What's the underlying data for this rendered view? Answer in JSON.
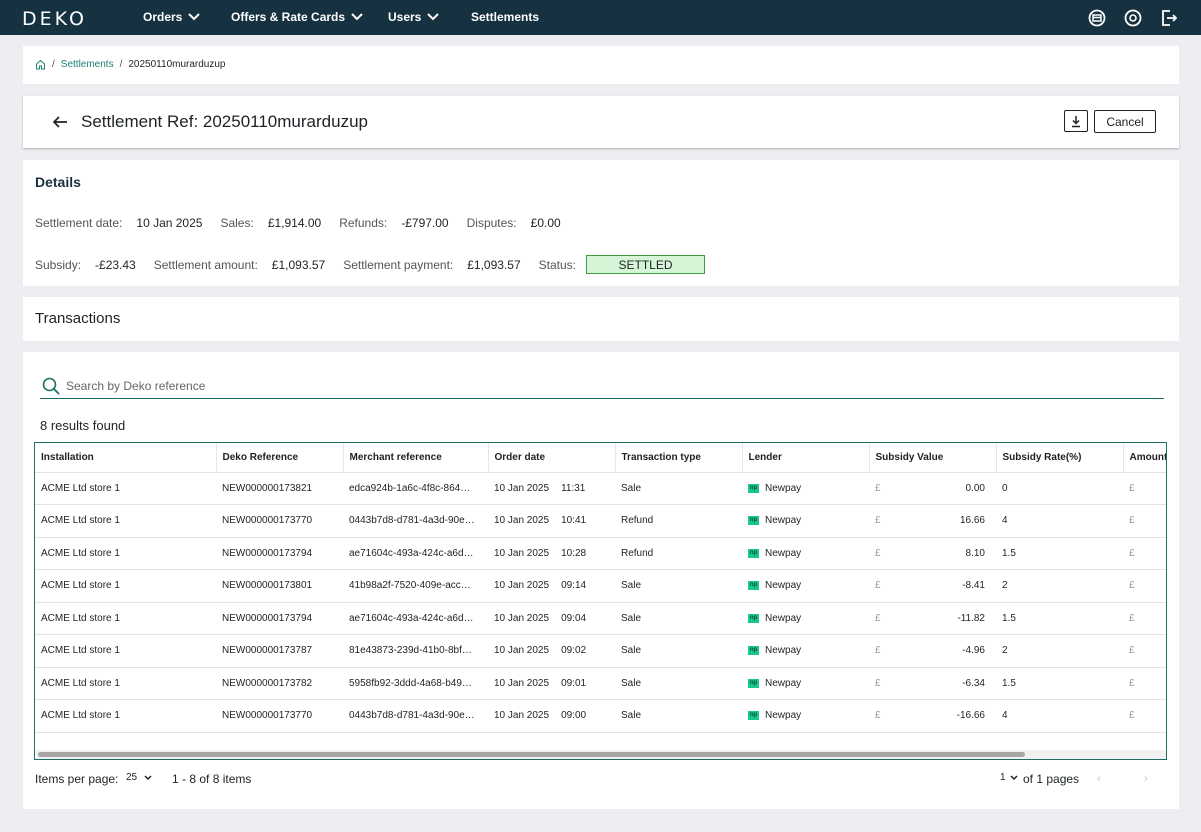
{
  "nav": {
    "logo": "DEKO",
    "items": [
      {
        "label": "Orders"
      },
      {
        "label": "Offers & Rate Cards"
      },
      {
        "label": "Users"
      },
      {
        "label": "Settlements"
      }
    ],
    "icons": [
      "store-icon",
      "account-icon",
      "logout-icon"
    ]
  },
  "breadcrumb": {
    "home_icon": "home-icon",
    "link": "Settlements",
    "separator": "/",
    "current": "20250110murarduzup"
  },
  "header": {
    "title": "Settlement Ref: 20250110murarduzup",
    "download_icon": "download-icon",
    "cancel_label": "Cancel"
  },
  "details": {
    "title": "Details",
    "settlement_date_label": "Settlement date:",
    "settlement_date": "10 Jan 2025",
    "sales_label": "Sales:",
    "sales": "£1,914.00",
    "refunds_label": "Refunds:",
    "refunds": "-£797.00",
    "disputes_label": "Disputes:",
    "disputes": "£0.00",
    "subsidy_label": "Subsidy:",
    "subsidy": "-£23.43",
    "settlement_amount_label": "Settlement amount:",
    "settlement_amount": "£1,093.57",
    "settlement_payment_label": "Settlement payment:",
    "settlement_payment": "£1,093.57",
    "status_label": "Status:",
    "status": "SETTLED",
    "status_color": "#d6f5d6"
  },
  "transactions": {
    "title": "Transactions",
    "search_placeholder": "Search by Deko reference",
    "results_text": "8 results found",
    "columns": [
      "Installation",
      "Deko Reference",
      "Merchant reference",
      "Order date",
      "Transaction type",
      "Lender",
      "Subsidy Value",
      "Subsidy Rate(%)",
      "Amount"
    ],
    "currency_symbol": "£",
    "lender_logo_text": "np",
    "rows": [
      {
        "installation": "ACME Ltd store 1",
        "deko_ref": "NEW000000173821",
        "merchant_ref": "edca924b-1a6c-4f8c-864…",
        "date": "10 Jan 2025",
        "time": "11:31",
        "type": "Sale",
        "lender": "Newpay",
        "subsidy_value": "0.00",
        "subsidy_rate": "0"
      },
      {
        "installation": "ACME Ltd store 1",
        "deko_ref": "NEW000000173770",
        "merchant_ref": "0443b7d8-d781-4a3d-90e…",
        "date": "10 Jan 2025",
        "time": "10:41",
        "type": "Refund",
        "lender": "Newpay",
        "subsidy_value": "16.66",
        "subsidy_rate": "4"
      },
      {
        "installation": "ACME Ltd store 1",
        "deko_ref": "NEW000000173794",
        "merchant_ref": "ae71604c-493a-424c-a6d…",
        "date": "10 Jan 2025",
        "time": "10:28",
        "type": "Refund",
        "lender": "Newpay",
        "subsidy_value": "8.10",
        "subsidy_rate": "1.5"
      },
      {
        "installation": "ACME Ltd store 1",
        "deko_ref": "NEW000000173801",
        "merchant_ref": "41b98a2f-7520-409e-acc…",
        "date": "10 Jan 2025",
        "time": "09:14",
        "type": "Sale",
        "lender": "Newpay",
        "subsidy_value": "-8.41",
        "subsidy_rate": "2"
      },
      {
        "installation": "ACME Ltd store 1",
        "deko_ref": "NEW000000173794",
        "merchant_ref": "ae71604c-493a-424c-a6d…",
        "date": "10 Jan 2025",
        "time": "09:04",
        "type": "Sale",
        "lender": "Newpay",
        "subsidy_value": "-11.82",
        "subsidy_rate": "1.5"
      },
      {
        "installation": "ACME Ltd store 1",
        "deko_ref": "NEW000000173787",
        "merchant_ref": "81e43873-239d-41b0-8bf…",
        "date": "10 Jan 2025",
        "time": "09:02",
        "type": "Sale",
        "lender": "Newpay",
        "subsidy_value": "-4.96",
        "subsidy_rate": "2"
      },
      {
        "installation": "ACME Ltd store 1",
        "deko_ref": "NEW000000173782",
        "merchant_ref": "5958fb92-3ddd-4a68-b49…",
        "date": "10 Jan 2025",
        "time": "09:01",
        "type": "Sale",
        "lender": "Newpay",
        "subsidy_value": "-6.34",
        "subsidy_rate": "1.5"
      },
      {
        "installation": "ACME Ltd store 1",
        "deko_ref": "NEW000000173770",
        "merchant_ref": "0443b7d8-d781-4a3d-90e…",
        "date": "10 Jan 2025",
        "time": "09:00",
        "type": "Sale",
        "lender": "Newpay",
        "subsidy_value": "-16.66",
        "subsidy_rate": "4"
      }
    ]
  },
  "pagination": {
    "items_per_page_label": "Items per page:",
    "items_per_page": "25",
    "range": "1 - 8 of 8 items",
    "page": "1",
    "of_pages": "of 1 pages",
    "prev": "‹",
    "next": "›"
  },
  "colors": {
    "nav_bg": "#16313f",
    "accent": "#1e7f6f",
    "status_border": "#3f9b3f",
    "lender_logo": "#18c98a"
  }
}
